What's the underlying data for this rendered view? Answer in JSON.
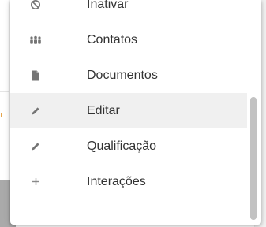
{
  "menu": {
    "items": [
      {
        "label": "Inativar",
        "icon": "ban-icon"
      },
      {
        "label": "Contatos",
        "icon": "contacts-group-icon"
      },
      {
        "label": "Documentos",
        "icon": "document-icon"
      },
      {
        "label": "Editar",
        "icon": "pencil-icon",
        "highlighted": true
      },
      {
        "label": "Qualificação",
        "icon": "pencil-icon"
      },
      {
        "label": "Interações",
        "icon": "plus-icon"
      }
    ]
  },
  "colors": {
    "menu_background": "#ffffff",
    "highlight": "#f0f0f0",
    "icon": "#757575",
    "text": "#333333",
    "scrollbar_thumb": "#c2c2c2",
    "accent_mark": "#e5a44b"
  }
}
